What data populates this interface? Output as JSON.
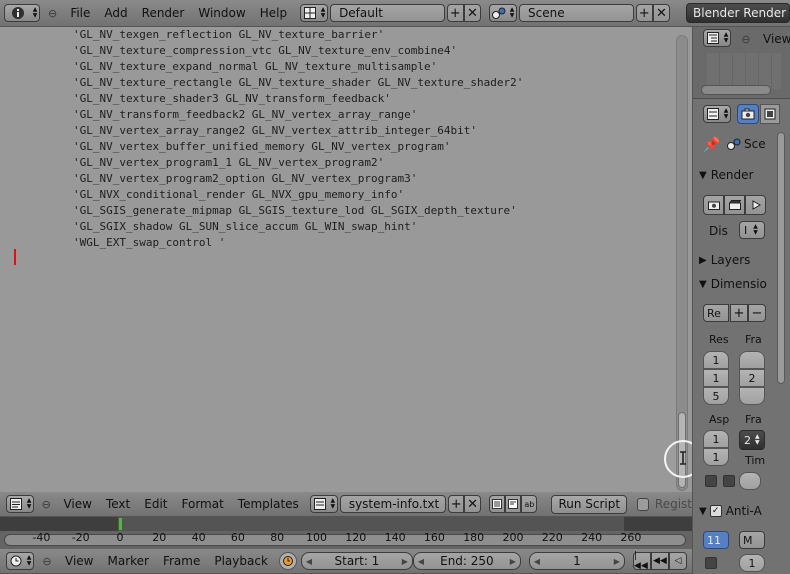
{
  "top_header": {
    "menus": [
      "File",
      "Add",
      "Render",
      "Window",
      "Help"
    ],
    "screen_layout": "Default",
    "scene": "Scene",
    "render_engine": "Blender Render"
  },
  "editor": {
    "lines": [
      "'GL_NV_texgen_reflection GL_NV_texture_barrier'",
      "'GL_NV_texture_compression_vtc GL_NV_texture_env_combine4'",
      "'GL_NV_texture_expand_normal GL_NV_texture_multisample'",
      "'GL_NV_texture_rectangle GL_NV_texture_shader GL_NV_texture_shader2'",
      "'GL_NV_texture_shader3 GL_NV_transform_feedback'",
      "'GL_NV_transform_feedback2 GL_NV_vertex_array_range'",
      "'GL_NV_vertex_array_range2 GL_NV_vertex_attrib_integer_64bit'",
      "'GL_NV_vertex_buffer_unified_memory GL_NV_vertex_program'",
      "'GL_NV_vertex_program1_1 GL_NV_vertex_program2'",
      "'GL_NV_vertex_program2_option GL_NV_vertex_program3'",
      "'GL_NVX_conditional_render GL_NVX_gpu_memory_info'",
      "'GL_SGIS_generate_mipmap GL_SGIS_texture_lod GL_SGIX_depth_texture'",
      "'GL_SGIX_shadow GL_SUN_slice_accum GL_WIN_swap_hint'",
      "'WGL_EXT_swap_control '"
    ]
  },
  "text_header": {
    "menus": [
      "View",
      "Text",
      "Edit",
      "Format",
      "Templates"
    ],
    "filename": "system-info.txt",
    "run_script": "Run Script",
    "register": "Regist"
  },
  "timeline": {
    "ticks": [
      "-40",
      "-20",
      "0",
      "20",
      "40",
      "60",
      "80",
      "100",
      "120",
      "140",
      "160",
      "180",
      "200",
      "220",
      "240",
      "260"
    ],
    "current_frame": 1,
    "menus": [
      "View",
      "Marker",
      "Frame",
      "Playback"
    ],
    "start": "Start: 1",
    "end": "End: 250",
    "frame": "1"
  },
  "properties": {
    "view_label": "View",
    "scene_label": "Sce",
    "render_header": "Render",
    "display_label": "Dis",
    "display_value": "I",
    "layers_header": "Layers",
    "dimensions_header": "Dimensio",
    "preset_value": "Re",
    "res_label": "Res",
    "fra_label": "Fra",
    "res_values": [
      "1",
      "1",
      "5"
    ],
    "fra_values": [
      "",
      "2",
      ""
    ],
    "asp_label": "Asp",
    "fra2_label": "Fra",
    "asp_values": [
      "1",
      "1"
    ],
    "fra2_value": "2",
    "time_label": "Tim",
    "antialias_header": "Anti-A",
    "aa_value": "11",
    "aa_filter": "M",
    "aa_size": "1"
  }
}
